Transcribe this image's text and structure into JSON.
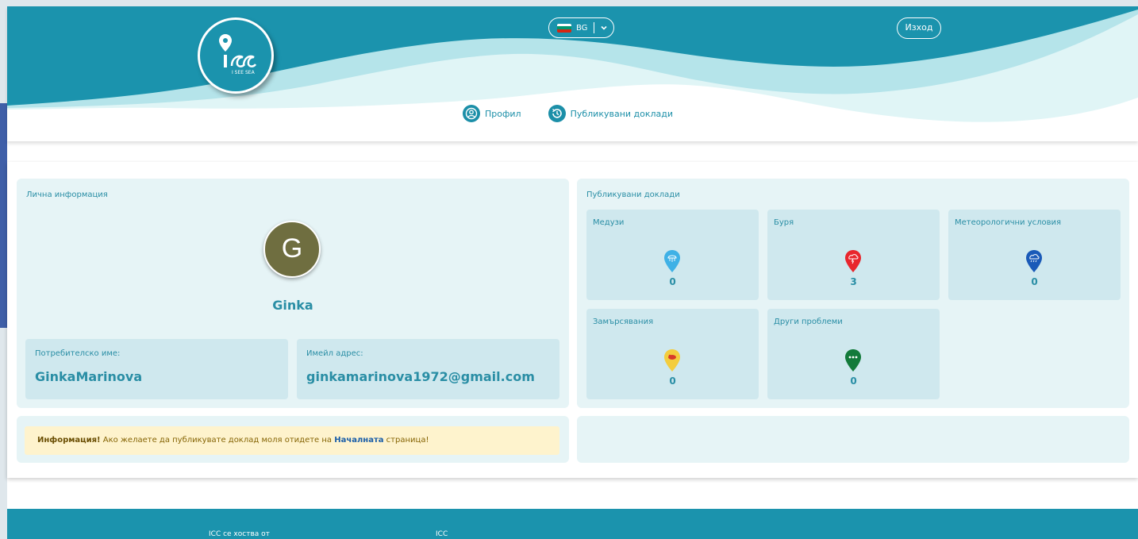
{
  "header": {
    "logo_text": "I SEE SEA",
    "language": "BG",
    "logout_label": "Изход",
    "nav": [
      {
        "label": "Профил",
        "icon": "user-icon"
      },
      {
        "label": "Публикувани доклади",
        "icon": "history-icon"
      }
    ]
  },
  "profile": {
    "section_title": "Лична информация",
    "avatar_letter": "G",
    "display_name": "Ginka",
    "username_label": "Потребителско име:",
    "username_value": "GinkaMarinova",
    "email_label": "Имейл адрес:",
    "email_value": "ginkamarinova1972@gmail.com"
  },
  "reports": {
    "section_title": "Публикувани доклади",
    "tiles": [
      {
        "label": "Медузи",
        "count": "0",
        "color": "#3fb1e6",
        "icon": "jellyfish-icon"
      },
      {
        "label": "Буря",
        "count": "3",
        "color": "#e8262d",
        "icon": "storm-icon"
      },
      {
        "label": "Метеорологични условия",
        "count": "0",
        "color": "#1a5ab8",
        "icon": "weather-icon"
      },
      {
        "label": "Замърсявания",
        "count": "0",
        "color": "#f3cd3e",
        "icon": "pollution-icon"
      },
      {
        "label": "Други проблеми",
        "count": "0",
        "color": "#127a3a",
        "icon": "other-problems-icon"
      }
    ]
  },
  "alert": {
    "strong": "Информация!",
    "text_before": " Ако желаете да публикувате доклад моля отидете на ",
    "link": "Началната",
    "text_after": " страница!"
  },
  "footer": {
    "hosted_by": "ICC се хоства от",
    "brand": "ICC"
  },
  "colors": {
    "primary": "#1b93ad",
    "panel_bg": "#e6f4f6",
    "box_bg": "#cfe8ee",
    "alert_bg": "#fef3cd"
  }
}
